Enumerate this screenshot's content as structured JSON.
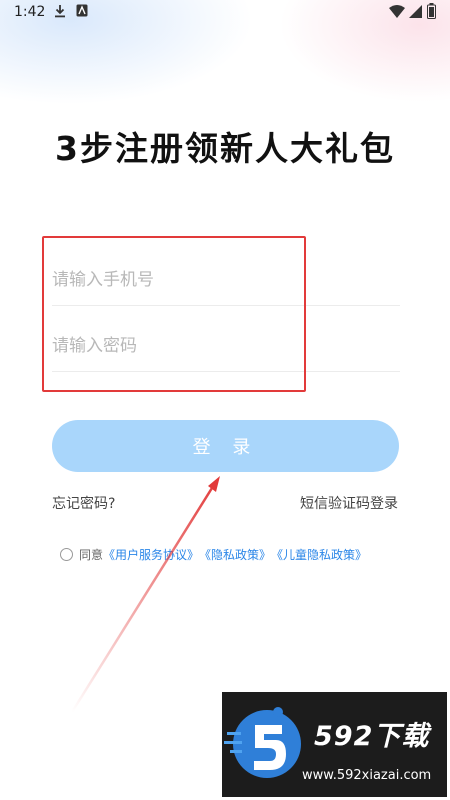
{
  "status_bar": {
    "time": "1:42",
    "left_icons": [
      "download-icon",
      "app-notification-icon"
    ],
    "right_icons": [
      "wifi-icon",
      "signal-icon",
      "battery-icon"
    ]
  },
  "title": "3步注册领新人大礼包",
  "form": {
    "phone_placeholder": "请输入手机号",
    "password_placeholder": "请输入密码"
  },
  "login_button": "登 录",
  "links": {
    "forgot_password": "忘记密码?",
    "sms_login": "短信验证码登录"
  },
  "agreement": {
    "prefix": "同意",
    "user_agreement": "《用户服务协议》",
    "privacy_policy": "《隐私政策》",
    "children_privacy": "《儿童隐私政策》"
  },
  "watermark": {
    "brand": "592下载",
    "url": "www.592xiazai.com"
  },
  "colors": {
    "button": "#a9d6fb",
    "link": "#2a86e8",
    "highlight": "#e23a3a"
  }
}
